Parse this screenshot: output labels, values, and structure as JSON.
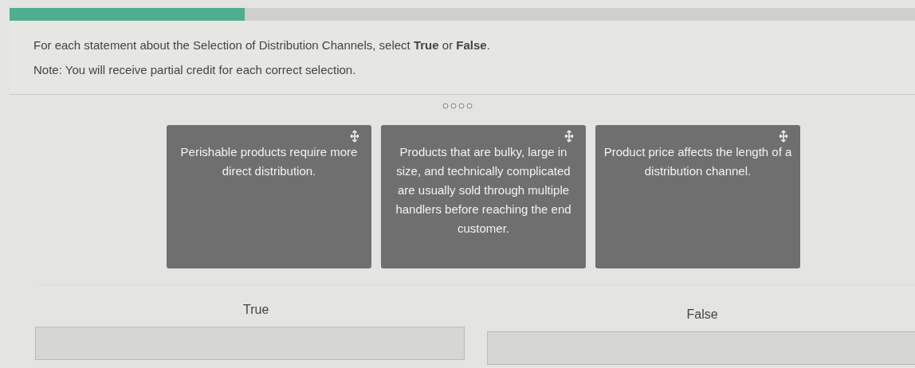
{
  "progress": {
    "level": 0.26
  },
  "instructions": "For each statement about the Selection of Distribution Channels, select **True** or **False**.",
  "note": "Note: You will receive partial credit for each correct selection.",
  "cards": [
    {
      "text": "Perishable products require more direct distribution."
    },
    {
      "text": "Products that are bulky, large in size, and technically complicated are usually sold through multiple handlers before reaching the end customer."
    },
    {
      "text": "Product price affects the length of a distribution channel."
    }
  ],
  "targets": [
    {
      "label": "True"
    },
    {
      "label": "False"
    }
  ]
}
